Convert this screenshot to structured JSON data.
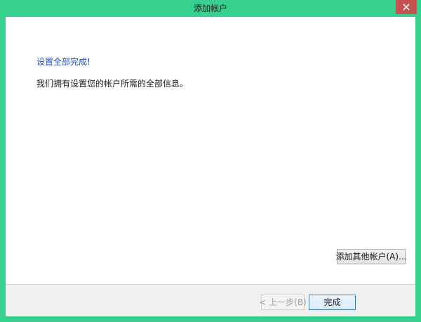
{
  "window": {
    "title": "添加帐户",
    "border_color": "#37d08e",
    "close_label": "close"
  },
  "content": {
    "heading": "设置全部完成!",
    "info": "我们拥有设置您的帐户所需的全部信息。",
    "add_other_button": "添加其他帐户(A)..."
  },
  "footer": {
    "back_button": "< 上一步(B)",
    "finish_button": "完成"
  },
  "colors": {
    "accent": "#37d08e",
    "heading": "#1f4fc4",
    "close": "#c75050"
  }
}
